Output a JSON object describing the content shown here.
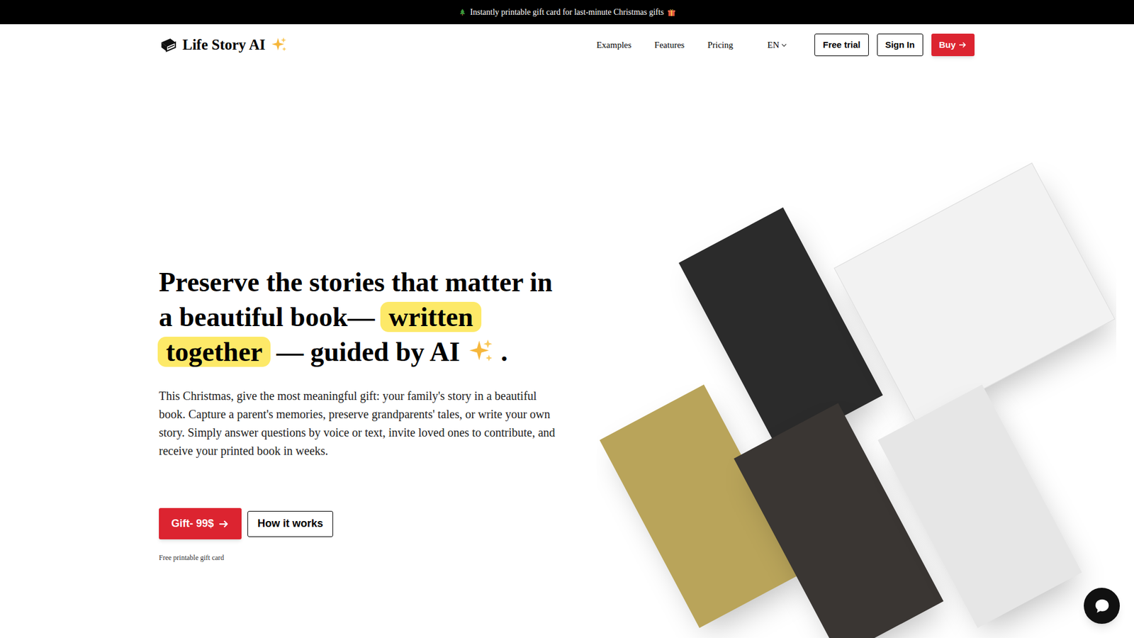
{
  "banner": {
    "text": "Instantly printable gift card for last-minute Christmas gifts"
  },
  "nav": {
    "logo": "Life Story AI",
    "links": [
      "Examples",
      "Features",
      "Pricing"
    ],
    "language": "EN",
    "buttons": [
      {
        "label": "Free trial",
        "kind": "outline"
      },
      {
        "label": "Sign In",
        "kind": "outline"
      },
      {
        "label": "Buy",
        "kind": "primary"
      }
    ]
  },
  "hero": {
    "heading": [
      {
        "text": "Preserve the stories that matter in a beautiful book— ",
        "highlighted": false
      },
      {
        "text": "written",
        "highlighted": true
      },
      {
        "text": " ",
        "highlighted": false
      },
      {
        "text": "together",
        "highlighted": true
      },
      {
        "text": " — guided by AI",
        "highlighted": false
      },
      {
        "text": " .",
        "highlighted": false
      }
    ],
    "description": "This Christmas, give the most meaningful gift: your family's story in a beautiful book. Capture a parent's memories, preserve grandparents' tales, or write your own story. Simply answer questions by voice or text, invite loved ones to contribute, and receive your printed book in weeks.",
    "buttons": [
      {
        "label": "Gift- 99$",
        "kind": "primary"
      },
      {
        "label": "How it works",
        "kind": "outline"
      }
    ],
    "note": "Free printable gift card"
  }
}
